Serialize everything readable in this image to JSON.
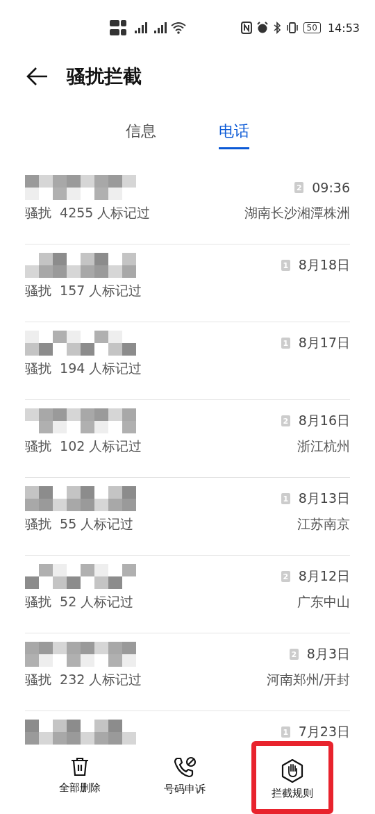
{
  "status_bar": {
    "battery": "50",
    "time": "14:53"
  },
  "header": {
    "title": "骚扰拦截"
  },
  "tabs": [
    {
      "label": "信息",
      "selected": false
    },
    {
      "label": "电话",
      "selected": true
    }
  ],
  "calls": [
    {
      "number_hidden": true,
      "sim": "2",
      "time": "09:36",
      "label": "骚扰  4255 人标记过",
      "location": "湖南长沙湘潭株洲"
    },
    {
      "number_hidden": true,
      "sim": "1",
      "time": "8月18日",
      "label": "骚扰  157 人标记过"
    },
    {
      "number_hidden": true,
      "sim": "1",
      "time": "8月17日",
      "label": "骚扰  194 人标记过"
    },
    {
      "number_hidden": true,
      "sim": "2",
      "time": "8月16日",
      "label": "骚扰  102 人标记过",
      "location": "浙江杭州"
    },
    {
      "number_hidden": true,
      "sim": "1",
      "time": "8月13日",
      "label": "骚扰  55 人标记过",
      "location": "江苏南京"
    },
    {
      "number_hidden": true,
      "sim": "2",
      "time": "8月12日",
      "label": "骚扰  52 人标记过",
      "location": "广东中山"
    },
    {
      "number_hidden": true,
      "sim": "2",
      "time": "8月3日",
      "label": "骚扰  232 人标记过",
      "location": "河南郑州/开封"
    },
    {
      "number_hidden": true,
      "sim": "1",
      "time": "7月23日"
    }
  ],
  "toolbar": [
    {
      "kind": "trash",
      "label": "全部删除",
      "highlighted": false
    },
    {
      "kind": "phone",
      "label": "号码申诉",
      "highlighted": false
    },
    {
      "kind": "hand",
      "label": "拦截规则",
      "highlighted": true
    }
  ]
}
